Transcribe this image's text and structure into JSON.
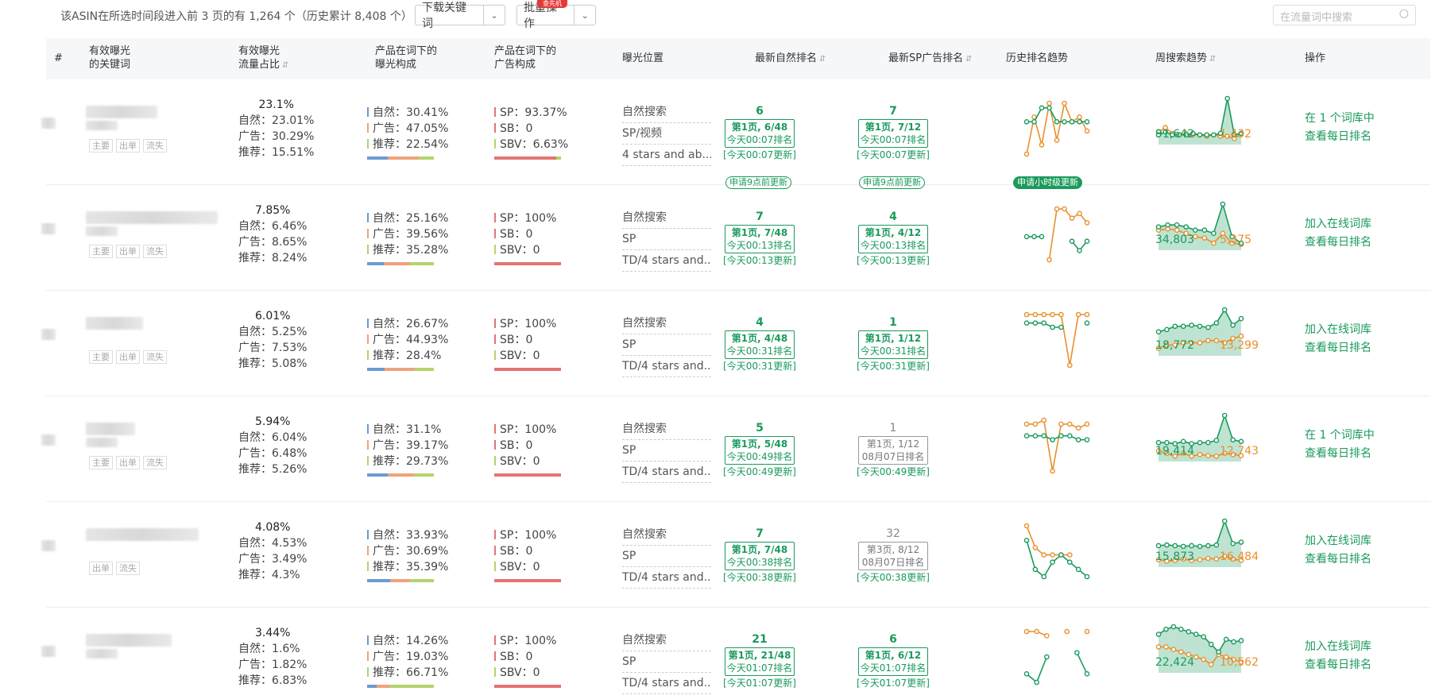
{
  "top": {
    "summary": "该ASIN在所选时间段进入前 3 页的有 1,264 个（历史累计 8,408 个）",
    "download_label": "下载关键词",
    "bulk_label": "批量操作",
    "new_badge": "查先机",
    "search_placeholder": "在流量词中搜索"
  },
  "headers": {
    "idx": "#",
    "kw1": "有效曝光",
    "kw2": "的关键词",
    "share1": "有效曝光",
    "share2": "流量占比",
    "expo1": "产品在词下的",
    "expo2": "曝光构成",
    "ad1": "产品在词下的",
    "ad2": "广告构成",
    "place": "曝光位置",
    "organic": "最新自然排名",
    "sp": "最新SP广告排名",
    "hist": "历史排名趋势",
    "weekly": "周搜索趋势",
    "ops": "操作"
  },
  "labels": {
    "natural": "自然：",
    "ads": "广告：",
    "rec": "推荐：",
    "sp": "SP：",
    "sb": "SB：",
    "sbv": "SBV：",
    "tag_main": "主要",
    "tag_order": "出单",
    "tag_loss": "流失"
  },
  "colors": {
    "accent": "#1a9a5c",
    "orange": "#e8902c",
    "blue": "#6b9bd2",
    "peach": "#f0a27c",
    "lime": "#b5d36b",
    "red": "#e57373"
  },
  "rows": [
    {
      "share": "23.1%",
      "s_nat": "23.01%",
      "s_ad": "30.29%",
      "s_rec": "15.51%",
      "e_nat": "30.41%",
      "e_ad": "47.05%",
      "e_rec": "22.54%",
      "a_sp": "93.37%",
      "a_sb": "0",
      "a_sbv": "6.63%",
      "places": [
        "自然搜索",
        "SP/视频",
        "4 stars and ab..."
      ],
      "org": {
        "num": "6",
        "page": "第1页, 6/48",
        "when": "今天00:07排名",
        "upd": "[今天00:07更新]",
        "active": true
      },
      "sp": {
        "num": "7",
        "page": "第1页, 7/12",
        "when": "今天00:07排名",
        "upd": "[今天00:07更新]",
        "active": true
      },
      "pill_org": "申请9点前更新",
      "pill_sp": "申请9点前更新",
      "pill_hist": "申请小时级更新",
      "hist_g": [
        5,
        5,
        2,
        2,
        5,
        5,
        5,
        5,
        5
      ],
      "hist_o": [
        12,
        4,
        10,
        1,
        9,
        1,
        5,
        4,
        7
      ],
      "wk_g": [
        40,
        44,
        40,
        40,
        40,
        42,
        40,
        40,
        40,
        42,
        90,
        40,
        42
      ],
      "wk_o": [
        44,
        50,
        42,
        40,
        42,
        40,
        40,
        38,
        40,
        38,
        38,
        35,
        42
      ],
      "wk_ng": "91,642",
      "wk_no": "1,432",
      "ops": [
        "在 1 个词库中",
        "查看每日排名"
      ],
      "tags": [
        "主要",
        "出单",
        "流失"
      ]
    },
    {
      "share": "7.85%",
      "s_nat": "6.46%",
      "s_ad": "8.65%",
      "s_rec": "8.24%",
      "e_nat": "25.16%",
      "e_ad": "39.56%",
      "e_rec": "35.28%",
      "a_sp": "100%",
      "a_sb": "0",
      "a_sbv": "0",
      "places": [
        "自然搜索",
        "SP",
        "TD/4 stars and..."
      ],
      "org": {
        "num": "7",
        "page": "第1页, 7/48",
        "when": "今天00:13排名",
        "upd": "[今天00:13更新]",
        "active": true
      },
      "sp": {
        "num": "4",
        "page": "第1页, 4/12",
        "when": "今天00:13排名",
        "upd": "[今天00:13更新]",
        "active": true
      },
      "hist_g": [
        7,
        7,
        7,
        null,
        null,
        null,
        8,
        10,
        8
      ],
      "hist_o": [
        null,
        null,
        null,
        12,
        1,
        1,
        3,
        2,
        4
      ],
      "wk_g": [
        55,
        58,
        58,
        55,
        50,
        50,
        45,
        90,
        40,
        30
      ],
      "wk_o": [
        50,
        52,
        50,
        45,
        40,
        38,
        30,
        45,
        30,
        28
      ],
      "wk_ng": "34,803",
      "wk_no": "5,375",
      "ops": [
        "加入在线词库",
        "查看每日排名"
      ],
      "tags": [
        "主要",
        "出单",
        "流失"
      ]
    },
    {
      "share": "6.01%",
      "s_nat": "5.25%",
      "s_ad": "7.53%",
      "s_rec": "5.08%",
      "e_nat": "26.67%",
      "e_ad": "44.93%",
      "e_rec": "28.4%",
      "a_sp": "100%",
      "a_sb": "0",
      "a_sbv": "0",
      "places": [
        "自然搜索",
        "SP",
        "TD/4 stars and..."
      ],
      "org": {
        "num": "4",
        "page": "第1页, 4/48",
        "when": "今天00:31排名",
        "upd": "[今天00:31更新]",
        "active": true
      },
      "sp": {
        "num": "1",
        "page": "第1页, 1/12",
        "when": "今天00:31排名",
        "upd": "[今天00:31更新]",
        "active": true
      },
      "hist_g": [
        4,
        4,
        4,
        5,
        5,
        null,
        null,
        4
      ],
      "hist_o": [
        2,
        2,
        2,
        2,
        2,
        14,
        2,
        2
      ],
      "wk_g": [
        50,
        52,
        55,
        55,
        56,
        55,
        54,
        58,
        70,
        56,
        62
      ],
      "wk_o": [
        35,
        38,
        38,
        40,
        40,
        40,
        42,
        42,
        40,
        44,
        46
      ],
      "wk_ng": "18,772",
      "wk_no": "13,299",
      "ops": [
        "加入在线词库",
        "查看每日排名"
      ],
      "tags": [
        "主要",
        "出单",
        "流失"
      ]
    },
    {
      "share": "5.94%",
      "s_nat": "6.04%",
      "s_ad": "6.48%",
      "s_rec": "5.26%",
      "e_nat": "31.1%",
      "e_ad": "39.17%",
      "e_rec": "29.73%",
      "a_sp": "100%",
      "a_sb": "0",
      "a_sbv": "0",
      "places": [
        "自然搜索",
        "SP",
        "TD/4 stars and..."
      ],
      "org": {
        "num": "5",
        "page": "第1页, 5/48",
        "when": "今天00:49排名",
        "upd": "[今天00:49更新]",
        "active": true
      },
      "sp": {
        "num": "1",
        "page": "第1页, 1/12",
        "when": "08月07日排名",
        "upd": "[今天00:49更新]",
        "active": false
      },
      "hist_g": [
        5,
        5,
        5,
        6,
        5,
        5,
        6,
        6
      ],
      "hist_o": [
        2,
        2,
        1,
        14,
        2,
        2,
        3,
        2
      ],
      "wk_g": [
        40,
        40,
        38,
        42,
        38,
        40,
        40,
        44,
        90,
        45,
        42
      ],
      "wk_o": [
        25,
        20,
        15,
        20,
        15,
        18,
        16,
        15,
        20,
        18,
        16
      ],
      "wk_ng": "19,414",
      "wk_no": "12,743",
      "ops": [
        "在 1 个词库中",
        "查看每日排名"
      ],
      "tags": [
        "主要",
        "出单",
        "流失"
      ]
    },
    {
      "share": "4.08%",
      "s_nat": "4.53%",
      "s_ad": "3.49%",
      "s_rec": "4.3%",
      "e_nat": "33.93%",
      "e_ad": "30.69%",
      "e_rec": "35.39%",
      "a_sp": "100%",
      "a_sb": "0",
      "a_sbv": "0",
      "places": [
        "自然搜索",
        "SP",
        "TD/4 stars and..."
      ],
      "org": {
        "num": "7",
        "page": "第1页, 7/48",
        "when": "今天00:38排名",
        "upd": "[今天00:38更新]",
        "active": true
      },
      "sp": {
        "num": "32",
        "page": "第3页, 8/12",
        "when": "08月07日排名",
        "upd": "[今天00:38更新]",
        "active": false
      },
      "hist_g": [
        2,
        6,
        7,
        5,
        4,
        5,
        6,
        7
      ],
      "hist_o": [
        0,
        3,
        4,
        4,
        4,
        4,
        null,
        null
      ],
      "wk_g": [
        55,
        56,
        55,
        54,
        55,
        54,
        55,
        56,
        90,
        58,
        60
      ],
      "wk_o": [
        35,
        33,
        34,
        36,
        34,
        35,
        37,
        36,
        40,
        36,
        34
      ],
      "wk_ng": "15,873",
      "wk_no": "16,484",
      "ops": [
        "加入在线词库",
        "查看每日排名"
      ],
      "tags": [
        "出单",
        "流失"
      ]
    },
    {
      "share": "3.44%",
      "s_nat": "1.6%",
      "s_ad": "1.82%",
      "s_rec": "6.83%",
      "e_nat": "14.26%",
      "e_ad": "19.03%",
      "e_rec": "66.71%",
      "a_sp": "100%",
      "a_sb": "0",
      "a_sbv": "0",
      "places": [
        "自然搜索",
        "SP",
        "TD/4 stars and..."
      ],
      "org": {
        "num": "21",
        "page": "第1页, 21/48",
        "when": "今天01:07排名",
        "upd": "[今天01:07更新]",
        "active": true
      },
      "sp": {
        "num": "6",
        "page": "第1页, 6/12",
        "when": "今天01:07排名",
        "upd": "[今天01:07更新]",
        "active": true
      },
      "hist_g": [
        12,
        14,
        8,
        null,
        null,
        7,
        12
      ],
      "hist_o": [
        2,
        2,
        3,
        null,
        2,
        null,
        2
      ],
      "wk_g": [
        60,
        64,
        66,
        64,
        62,
        60,
        58,
        52,
        46,
        56,
        54,
        55
      ],
      "wk_o": [
        50,
        50,
        48,
        46,
        44,
        42,
        40,
        36,
        44,
        42,
        40,
        38
      ],
      "wk_ng": "22,424",
      "wk_no": "10,562",
      "ops": [
        "加入在线词库",
        "查看每日排名"
      ],
      "tags": []
    }
  ]
}
